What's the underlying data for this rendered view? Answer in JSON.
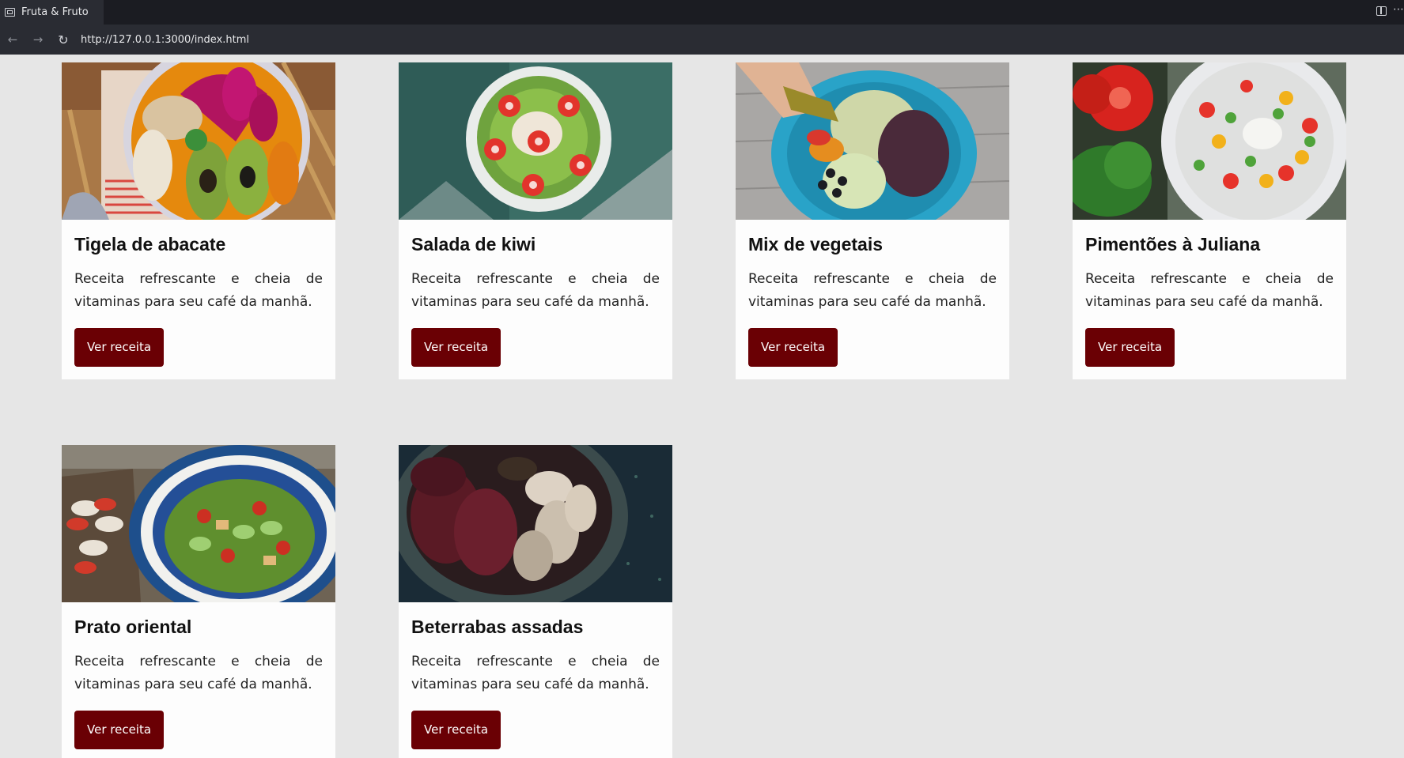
{
  "browser": {
    "tab_title": "Fruta & Fruto",
    "url": "http://127.0.0.1:3000/index.html",
    "back_icon": "←",
    "forward_icon": "→",
    "reload_icon": "↻",
    "more_icon": "⋯"
  },
  "colors": {
    "accent": "#6a0004",
    "background": "#e6e6e6",
    "card": "#fdfdfd"
  },
  "cards": [
    {
      "title": "Tigela de abacate",
      "description": "Receita refrescante e cheia de vitaminas para seu café da manhã.",
      "button": "Ver receita",
      "image": "acai-avocado-bowl-photo"
    },
    {
      "title": "Salada de kiwi",
      "description": "Receita refrescante e cheia de vitaminas para seu café da manhã.",
      "button": "Ver receita",
      "image": "kiwi-strawberry-bowl-photo"
    },
    {
      "title": "Mix de vegetais",
      "description": "Receita refrescante e cheia de vitaminas para seu café da manhã.",
      "button": "Ver receita",
      "image": "vegetable-mix-plate-photo"
    },
    {
      "title": "Pimentões à Juliana",
      "description": "Receita refrescante e cheia de vitaminas para seu café da manhã.",
      "button": "Ver receita",
      "image": "pepper-salad-plate-photo"
    },
    {
      "title": "Prato oriental",
      "description": "Receita refrescante e cheia de vitaminas para seu café da manhã.",
      "button": "Ver receita",
      "image": "oriental-salad-bowl-photo"
    },
    {
      "title": "Beterrabas assadas",
      "description": "Receita refrescante e cheia de vitaminas para seu café da manhã.",
      "button": "Ver receita",
      "image": "roasted-beets-bowl-photo"
    }
  ]
}
